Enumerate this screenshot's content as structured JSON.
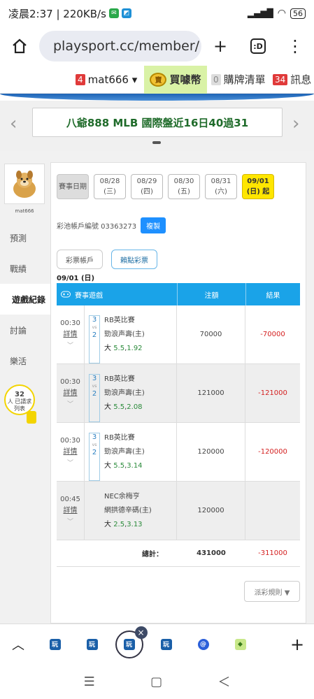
{
  "statusbar": {
    "time": "凌晨2:37 | 220KB/s",
    "battery": "56"
  },
  "address": {
    "url": "playsport.cc/member/",
    "tab_label": ":D"
  },
  "sitebar": {
    "user_badge": "4",
    "user": "mat666 ▾",
    "coin_icon": "賣",
    "coin_label": "買噱幣",
    "cart_badge": "0",
    "cart_label": "購牌清單",
    "msg_badge": "34",
    "msg_label": "訊息"
  },
  "banner": {
    "text": "八爺888 MLB 國際盤近16日40過31"
  },
  "leftnav": {
    "avatar_name": "mat666",
    "items": [
      "預測",
      "戰績",
      "遊戲紀錄",
      "討論",
      "樂活"
    ],
    "bulb_count": "32",
    "bulb_text": "人 已請求列表"
  },
  "datetabs": [
    {
      "label": "賽事日期",
      "sub": ""
    },
    {
      "label": "08/28",
      "sub": "(三)"
    },
    {
      "label": "08/29",
      "sub": "(四)"
    },
    {
      "label": "08/30",
      "sub": "(五)"
    },
    {
      "label": "08/31",
      "sub": "(六)"
    },
    {
      "label": "09/01",
      "sub": "(日) 起"
    }
  ],
  "account": {
    "label": "彩池帳戶編號 03363273",
    "copy_button": "複製"
  },
  "subtabs": [
    "彩票帳戶",
    "賴點彩票"
  ],
  "date_title": "09/01 (日)",
  "table": {
    "headers": {
      "game": "賽事遊戲",
      "bet": "注額",
      "result": "結果"
    },
    "rows": [
      {
        "time": "00:30",
        "link": "詳情",
        "score_top": "3",
        "score_vs": "vs",
        "score_bot": "2",
        "league": "RB英比賽",
        "team": "勁浪声壽(主)",
        "pick": "大",
        "line": "5.5",
        "odds": "1.92",
        "bet": "70000",
        "result": "-70000"
      },
      {
        "time": "00:30",
        "link": "詳情",
        "score_top": "3",
        "score_vs": "vs",
        "score_bot": "2",
        "league": "RB英比賽",
        "team": "勁浪声壽(主)",
        "pick": "大",
        "line": "5.5",
        "odds": "2.08",
        "bet": "121000",
        "result": "-121000"
      },
      {
        "time": "00:30",
        "link": "詳情",
        "score_top": "3",
        "score_vs": "vs",
        "score_bot": "2",
        "league": "RB英比賽",
        "team": "勁浪声壽(主)",
        "pick": "大",
        "line": "5.5",
        "odds": "3.14",
        "bet": "120000",
        "result": "-120000"
      },
      {
        "time": "00:45",
        "link": "詳情",
        "score_top": "",
        "score_vs": "",
        "score_bot": "",
        "league": "NEC余梅亨",
        "team": "網拱德辛碼(主)",
        "pick": "大",
        "line": "2.5",
        "odds": "3.13",
        "bet": "120000",
        "result": ""
      }
    ],
    "total_label": "總計：",
    "total_bet": "431000",
    "total_result": "-311000"
  },
  "rules_button": "派彩規則 ▼",
  "tabstrip": {
    "favicon": "玩",
    "close": "×",
    "plus": "+"
  },
  "navbar": {
    "menu": "☰",
    "home": "▢",
    "back": "＜"
  }
}
